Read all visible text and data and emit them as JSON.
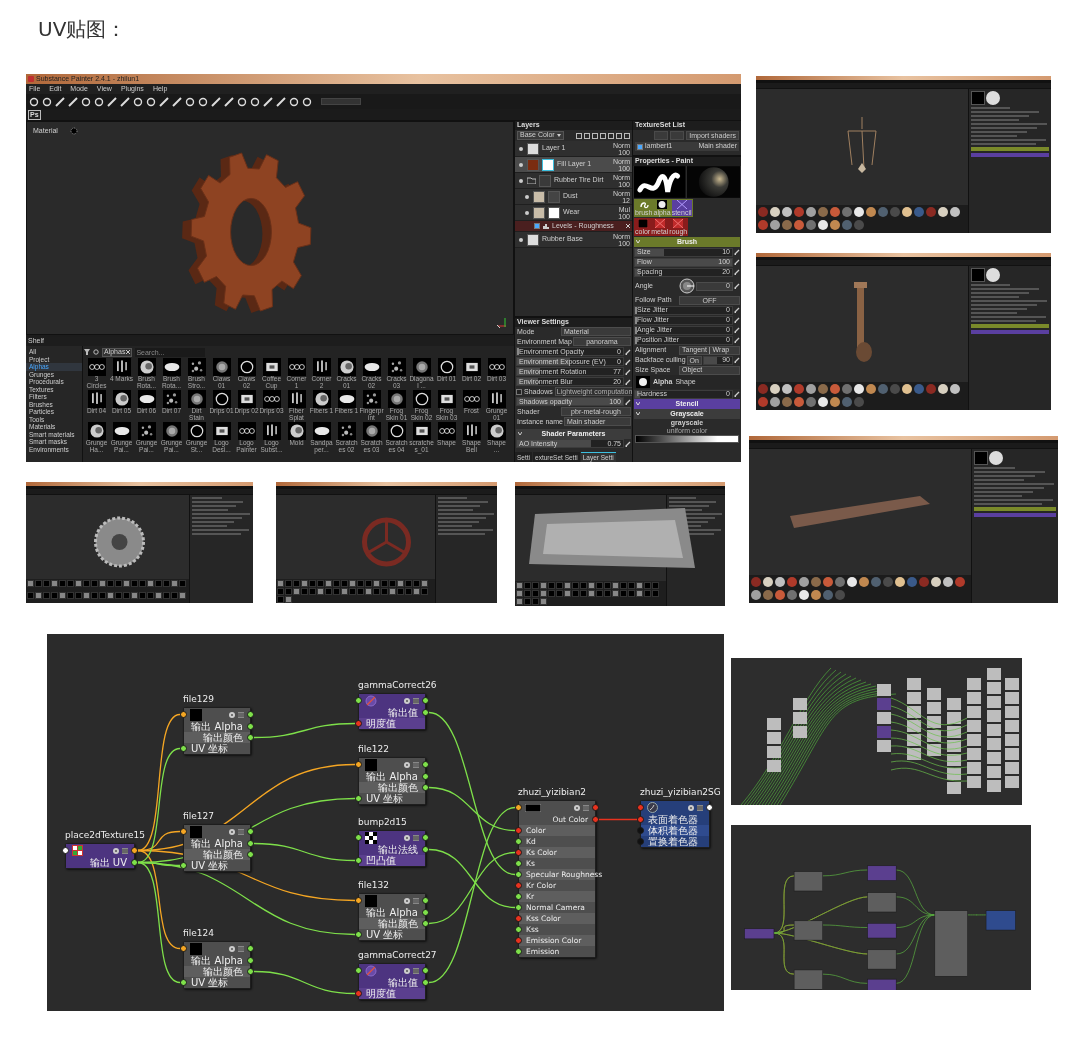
{
  "title": "UV贴图：",
  "painter": {
    "window_title": "Substance Painter 2.4.1 - zhilun1",
    "menu": [
      "File",
      "Edit",
      "Mode",
      "View",
      "Plugins",
      "Help"
    ],
    "ps_button": "Ps",
    "viewport_label": "Material",
    "layers": {
      "title": "Layers",
      "channel": "Base Color",
      "items": [
        {
          "name": "Layer 1",
          "kind": "paint",
          "blend": "Norm",
          "opacity": "100",
          "selected": false
        },
        {
          "name": "Fill Layer 1",
          "kind": "fill",
          "blend": "Norm",
          "opacity": "100",
          "selected": true
        },
        {
          "name": "Rubber Tire Dirt",
          "kind": "folder",
          "blend": "Norm",
          "opacity": "100",
          "selected": false,
          "children": [
            {
              "name": "Dust",
              "kind": "paint",
              "blend": "Norm",
              "opacity": "12",
              "selected": false
            },
            {
              "name": "Wear",
              "kind": "paint",
              "blend": "Mul",
              "opacity": "100",
              "selected": false,
              "children": [
                {
                  "name": "Levels - Roughness",
                  "kind": "effect",
                  "enabled": true,
                  "selected": false
                }
              ]
            }
          ]
        },
        {
          "name": "Rubber Base",
          "kind": "paint",
          "blend": "Norm",
          "opacity": "100",
          "selected": false
        }
      ]
    },
    "texture_set": {
      "title": "TextureSet List",
      "button": "Import shaders",
      "items": [
        {
          "name": "lambert1",
          "shader": "Main shader",
          "visible": true
        }
      ]
    },
    "properties": {
      "title": "Properties - Paint",
      "brush_slots": [
        "brush",
        "alpha",
        "stencil"
      ],
      "material_slots": [
        "color",
        "metal",
        "rough"
      ],
      "brush_section": "Brush",
      "params": [
        {
          "kind": "slider",
          "label": "Size",
          "value": "10",
          "level": 0.3
        },
        {
          "kind": "slider",
          "label": "Flow",
          "value": "100",
          "level": 1
        },
        {
          "kind": "slider",
          "label": "Spacing",
          "value": "20",
          "level": 0.05
        },
        {
          "kind": "angle",
          "label": "Angle",
          "value": "0"
        },
        {
          "kind": "toggle",
          "label": "Follow Path",
          "value": "OFF"
        },
        {
          "kind": "slider",
          "label": "Size Jitter",
          "value": "0",
          "level": 0
        },
        {
          "kind": "slider",
          "label": "Flow Jitter",
          "value": "0",
          "level": 0
        },
        {
          "kind": "slider",
          "label": "Angle Jitter",
          "value": "0",
          "level": 0
        },
        {
          "kind": "slider",
          "label": "Position Jitter",
          "value": "0",
          "level": 0
        },
        {
          "kind": "dropdown",
          "label": "Alignment",
          "value": "Tangent | Wrap"
        },
        {
          "kind": "toggle_slider",
          "label": "Backface culling",
          "value": "On",
          "reading": "90",
          "level": 0.45
        },
        {
          "kind": "dropdown",
          "label": "Size Space",
          "value": "Object"
        }
      ],
      "alpha": {
        "name": "Alpha",
        "type": "Shape"
      },
      "hardness": {
        "label": "Hardness",
        "value": "0",
        "level": 0.05
      },
      "stencil_section": "Stencil",
      "grayscale_section": "Grayscale",
      "grayscale_name": "grayscale",
      "grayscale_type": "uniform color"
    },
    "viewer": {
      "title": "Viewer Settings",
      "params": [
        {
          "kind": "dropdown",
          "label": "Mode",
          "value": "Material"
        },
        {
          "kind": "button",
          "label": "Environment Map",
          "value": "panorama"
        },
        {
          "kind": "slider",
          "label": "Environment Opacity",
          "value": "0",
          "level": 0
        },
        {
          "kind": "slider",
          "label": "Environment Exposure (EV)",
          "value": "0",
          "level": 0.5
        },
        {
          "kind": "slider",
          "label": "Environment Rotation",
          "value": "77",
          "level": 0.22
        },
        {
          "kind": "slider",
          "label": "Environment Blur",
          "value": "20",
          "level": 0.2
        },
        {
          "kind": "check",
          "label": "Shadows",
          "value": "Lightweight computation",
          "checked": false
        },
        {
          "kind": "slider",
          "label": "Shadows opacity",
          "value": "100",
          "level": 1
        },
        {
          "kind": "button",
          "label": "Shader",
          "value": "pbr-metal-rough"
        },
        {
          "kind": "text",
          "label": "Instance name",
          "value": "Main shader"
        }
      ],
      "section": "Shader Parameters",
      "ao": {
        "label": "AO Intensity",
        "value": "0.75",
        "level": 0.7
      },
      "tabs": [
        {
          "label": "Setti",
          "selected": false
        },
        {
          "label": "extureSet Setti",
          "selected": false
        },
        {
          "label": "Layer Setti",
          "selected": true
        }
      ]
    },
    "shelf": {
      "title": "Shelf",
      "filter": "Alphas",
      "search_placeholder": "Search...",
      "categories": [
        {
          "label": "All",
          "selected": false
        },
        {
          "label": "Project",
          "selected": false
        },
        {
          "label": "Alphas",
          "selected": true
        },
        {
          "label": "Grunges",
          "selected": false
        },
        {
          "label": "Procedurals",
          "selected": false
        },
        {
          "label": "Textures",
          "selected": false
        },
        {
          "label": "Filters",
          "selected": false
        },
        {
          "label": "Brushes",
          "selected": false
        },
        {
          "label": "Particles",
          "selected": false
        },
        {
          "label": "Tools",
          "selected": false
        },
        {
          "label": "Materials",
          "selected": false
        },
        {
          "label": "Smart materials",
          "selected": false
        },
        {
          "label": "Smart masks",
          "selected": false
        },
        {
          "label": "Environments",
          "selected": false
        }
      ],
      "items": [
        "3 Circles",
        "4 Marks",
        "Brush Rota...",
        "Brush Rota...",
        "Brush Stro...",
        "Claws 01",
        "Claws 02",
        "Coffee Cup",
        "Corner 1",
        "Corner 2",
        "Cracks 01",
        "Cracks 02",
        "Cracks 03",
        "Diagonal ...",
        "Dirt 01",
        "Dirt 02",
        "Dirt 03",
        "Dirt 04",
        "Dirt 05",
        "Dirt 06",
        "Dirt 07",
        "Dirt Stain",
        "Drips 01",
        "Drips 02",
        "Drips 03",
        "Fiber Splat",
        "Fibers 1",
        "Fibers 1",
        "Fingerprint",
        "Frog Skin 01",
        "Frog Skin 02",
        "Frog Skin 03",
        "Frost",
        "Grunge 01",
        "Grunge Ha...",
        "Grunge Pai...",
        "Grunge Pai...",
        "Grunge Pai...",
        "Grunge St...",
        "Logo Desi...",
        "Logo Painter",
        "Logo Subst...",
        "Mold",
        "Sandpaper...",
        "Scratches 02",
        "Scratches 03",
        "Scratches 04",
        "scratches_01",
        "Shape",
        "Shape Bell",
        "Shape ..."
      ]
    }
  },
  "node_graph": {
    "nodes": [
      {
        "title": "place2dTexture15",
        "kind": "utility",
        "in_port": {
          "color": "#ffffff"
        },
        "out_port": {
          "color": "#f5a623"
        },
        "rows": [
          {
            "label": "输出 UV",
            "kind": "output",
            "color": "#7ee04a"
          }
        ]
      },
      {
        "title": "file129",
        "kind": "texture",
        "in_port": {
          "color": "#f5a623"
        },
        "out_port": {
          "color": "#7ee04a"
        },
        "rows": [
          {
            "label": "输出 Alpha",
            "kind": "output",
            "color": "#7ee04a"
          },
          {
            "label": "输出颜色",
            "kind": "output",
            "color": "#7ee04a"
          },
          {
            "label": "UV 坐标",
            "kind": "input",
            "color": "#7ee04a"
          }
        ]
      },
      {
        "title": "file127",
        "kind": "texture",
        "in_port": {
          "color": "#f5a623"
        },
        "out_port": {
          "color": "#7ee04a"
        },
        "rows": [
          {
            "label": "输出 Alpha",
            "kind": "output",
            "color": "#7ee04a"
          },
          {
            "label": "输出颜色",
            "kind": "output",
            "color": "#7ee04a"
          },
          {
            "label": "UV 坐标",
            "kind": "input",
            "color": "#7ee04a"
          }
        ]
      },
      {
        "title": "file124",
        "kind": "texture",
        "in_port": {
          "color": "#f5a623"
        },
        "out_port": {
          "color": "#7ee04a"
        },
        "rows": [
          {
            "label": "输出 Alpha",
            "kind": "output",
            "color": "#7ee04a"
          },
          {
            "label": "输出颜色",
            "kind": "output",
            "color": "#7ee04a"
          },
          {
            "label": "UV 坐标",
            "kind": "input",
            "color": "#7ee04a"
          }
        ]
      },
      {
        "title": "gammaCorrect26",
        "kind": "utility",
        "in_port": {
          "color": "#7ee04a"
        },
        "out_port": {
          "color": "#7ee04a"
        },
        "rows": [
          {
            "label": "输出值",
            "kind": "output",
            "color": "#7ee04a"
          },
          {
            "label": "明度值",
            "kind": "input",
            "color": "#e8321e"
          }
        ]
      },
      {
        "title": "file122",
        "kind": "texture",
        "in_port": {
          "color": "#f5a623"
        },
        "out_port": {
          "color": "#7ee04a"
        },
        "rows": [
          {
            "label": "输出 Alpha",
            "kind": "output",
            "color": "#7ee04a"
          },
          {
            "label": "输出颜色",
            "kind": "output",
            "color": "#7ee04a"
          },
          {
            "label": "UV 坐标",
            "kind": "input",
            "color": "#7ee04a"
          }
        ]
      },
      {
        "title": "bump2d15",
        "kind": "utility",
        "in_port": {
          "color": "#7ee04a"
        },
        "out_port": {
          "color": "#7ee04a"
        },
        "rows": [
          {
            "label": "输出法线",
            "kind": "output",
            "color": "#7ee04a"
          },
          {
            "label": "凹凸值",
            "kind": "input",
            "color": "#7ee04a"
          }
        ]
      },
      {
        "title": "file132",
        "kind": "texture",
        "in_port": {
          "color": "#f5a623"
        },
        "out_port": {
          "color": "#7ee04a"
        },
        "rows": [
          {
            "label": "输出 Alpha",
            "kind": "output",
            "color": "#7ee04a"
          },
          {
            "label": "输出颜色",
            "kind": "output",
            "color": "#7ee04a"
          },
          {
            "label": "UV 坐标",
            "kind": "input",
            "color": "#7ee04a"
          }
        ]
      },
      {
        "title": "gammaCorrect27",
        "kind": "utility",
        "in_port": {
          "color": "#7ee04a"
        },
        "out_port": {
          "color": "#7ee04a"
        },
        "rows": [
          {
            "label": "输出值",
            "kind": "output",
            "color": "#7ee04a"
          },
          {
            "label": "明度值",
            "kind": "input",
            "color": "#e8321e"
          }
        ]
      },
      {
        "title": "zhuzi_yizibian2",
        "kind": "shader",
        "in_port": {
          "color": "#f5a623"
        },
        "out_port": {
          "color": "#e8321e"
        },
        "rows": [
          {
            "label": "Out Color",
            "kind": "output",
            "color": "#e8321e"
          },
          {
            "label": "Color",
            "kind": "input",
            "color": "#e8321e"
          },
          {
            "label": "Kd",
            "kind": "input",
            "color": "#7ee04a"
          },
          {
            "label": "Ks Color",
            "kind": "input",
            "color": "#e8321e"
          },
          {
            "label": "Ks",
            "kind": "input",
            "color": "#7ee04a"
          },
          {
            "label": "Specular Roughness",
            "kind": "input",
            "color": "#7ee04a"
          },
          {
            "label": "Kr Color",
            "kind": "input",
            "color": "#e8321e"
          },
          {
            "label": "Kr",
            "kind": "input",
            "color": "#7ee04a"
          },
          {
            "label": "Normal Camera",
            "kind": "input",
            "color": "#7ee04a"
          },
          {
            "label": "Kss Color",
            "kind": "input",
            "color": "#e8321e"
          },
          {
            "label": "Kss",
            "kind": "input",
            "color": "#7ee04a"
          },
          {
            "label": "Emission Color",
            "kind": "input",
            "color": "#e8321e"
          },
          {
            "label": "Emission",
            "kind": "input",
            "color": "#7ee04a"
          }
        ]
      },
      {
        "title": "zhuzi_yizibian2SG",
        "kind": "shading_group",
        "in_port": {
          "color": "#e8321e"
        },
        "out_port": {
          "color": "#ffffff"
        },
        "rows": [
          {
            "label": "表面着色器",
            "kind": "input",
            "color": "#e8321e"
          },
          {
            "label": "体积着色器",
            "kind": "input",
            "color": "#111111"
          },
          {
            "label": "置换着色器",
            "kind": "input",
            "color": "#111111"
          }
        ]
      }
    ]
  }
}
